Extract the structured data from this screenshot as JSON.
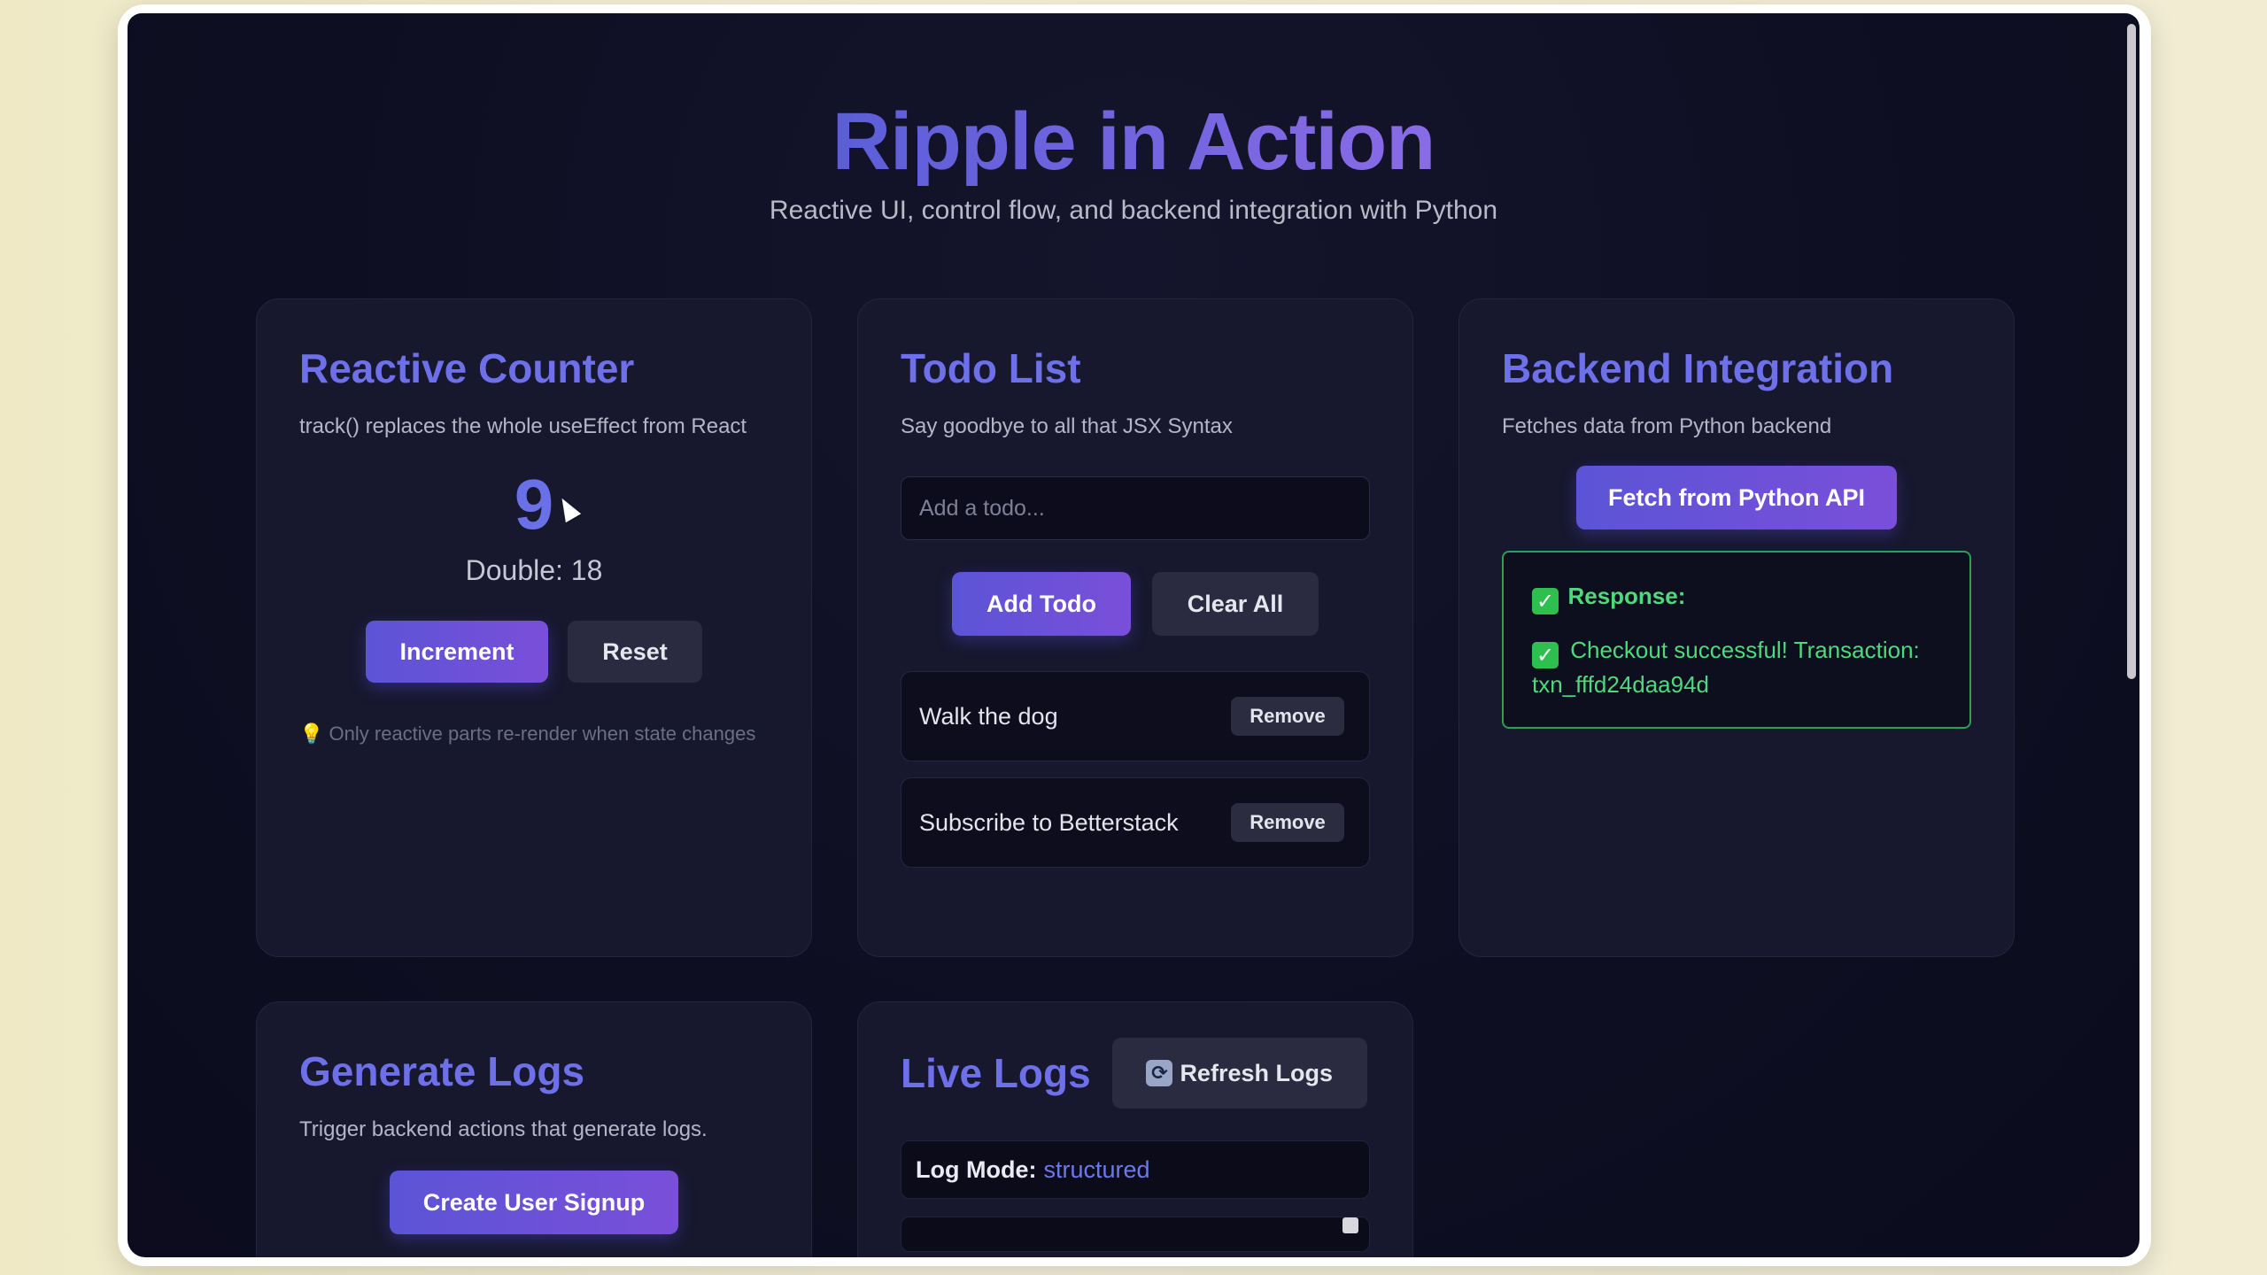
{
  "header": {
    "title": "Ripple in Action",
    "subtitle": "Reactive UI, control flow, and backend integration with Python"
  },
  "counter": {
    "title": "Reactive Counter",
    "description": "track() replaces the whole useEffect from React",
    "value": "9",
    "double": "Double: 18",
    "increment_label": "Increment",
    "reset_label": "Reset",
    "tip_icon": "💡",
    "tip": "Only reactive parts re-render when state changes"
  },
  "todo": {
    "title": "Todo List",
    "description": "Say goodbye to all that JSX Syntax",
    "input_placeholder": "Add a todo...",
    "add_label": "Add Todo",
    "clear_label": "Clear All",
    "items": [
      {
        "text": "Walk the dog",
        "remove_label": "Remove"
      },
      {
        "text": "Subscribe to Betterstack",
        "remove_label": "Remove"
      }
    ]
  },
  "backend": {
    "title": "Backend Integration",
    "description": "Fetches data from Python backend",
    "fetch_label": "Fetch from Python API",
    "check_glyph": "✓",
    "response_label": "Response:",
    "response_message": "Checkout successful! Transaction: txn_fffd24daa94d"
  },
  "generate_logs": {
    "title": "Generate Logs",
    "description": "Trigger backend actions that generate logs.",
    "signup_label": "Create User Signup"
  },
  "live_logs": {
    "title": "Live Logs",
    "refresh_glyph": "⟳",
    "refresh_label": "Refresh Logs",
    "mode_label": "Log Mode:",
    "mode_value": "structured"
  }
}
